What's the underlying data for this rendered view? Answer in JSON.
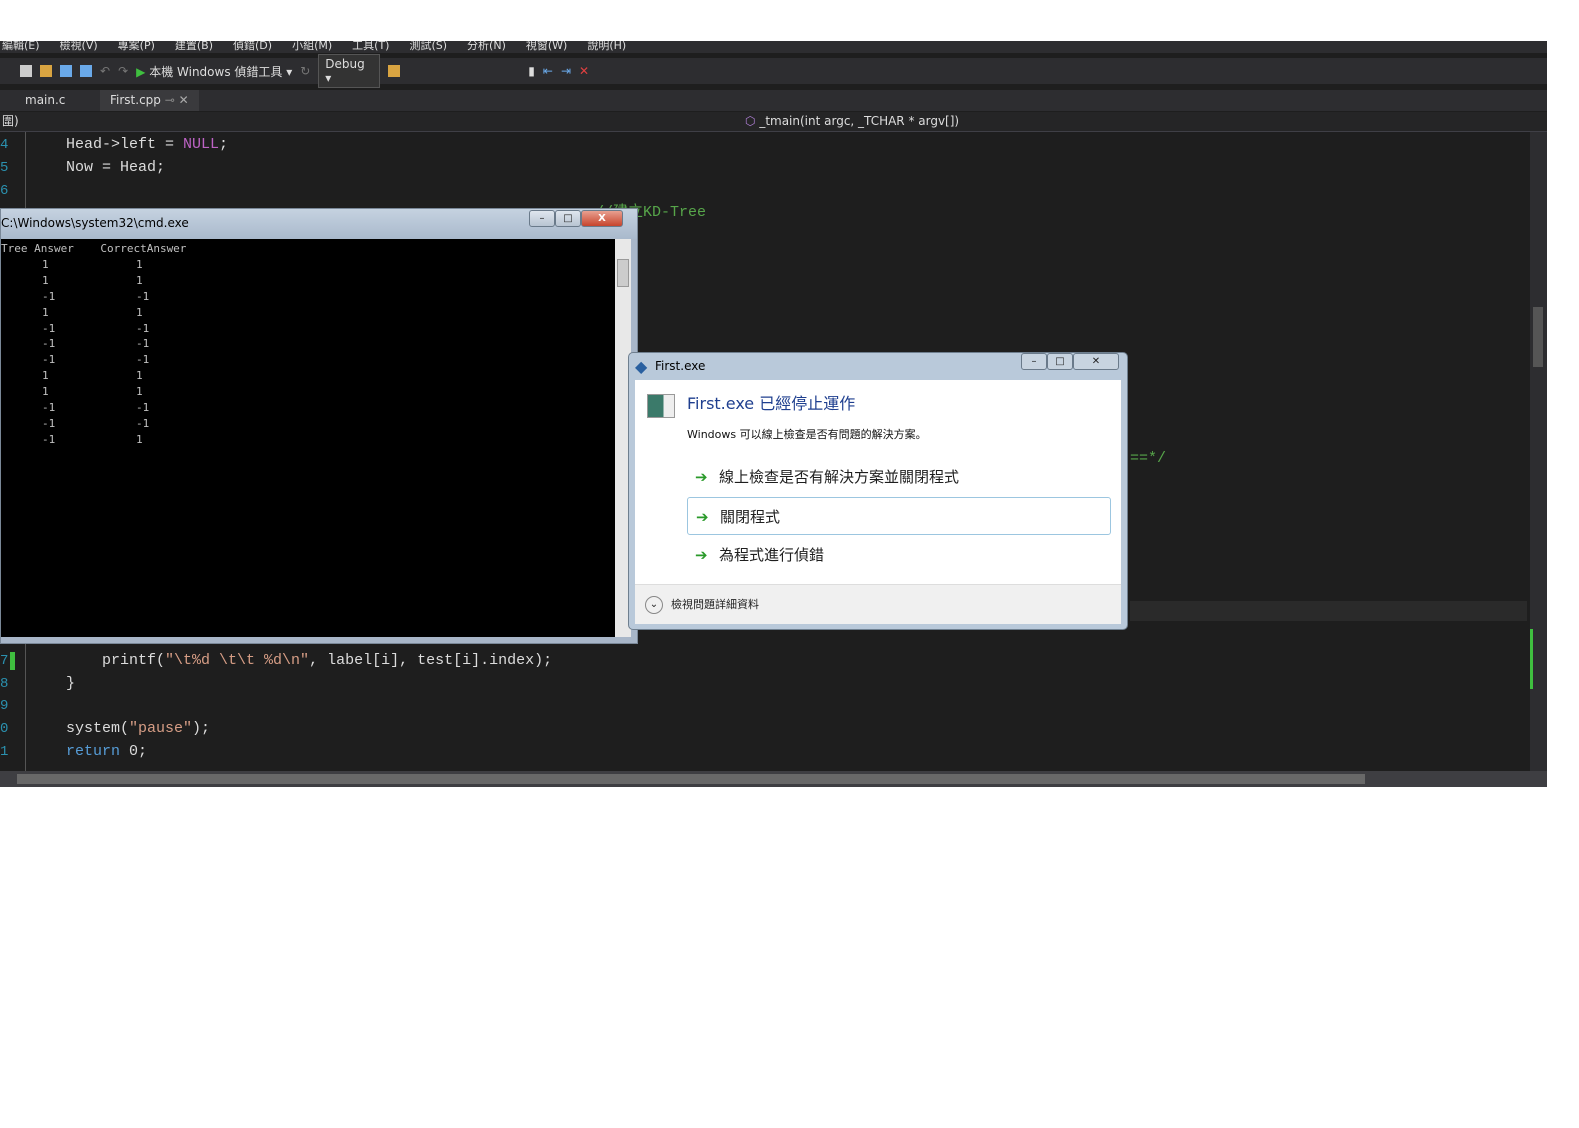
{
  "menu": [
    "編輯(E)",
    "檢視(V)",
    "專案(P)",
    "建置(B)",
    "偵錯(D)",
    "小組(M)",
    "工具(T)",
    "測試(S)",
    "分析(N)",
    "視窗(W)",
    "說明(H)"
  ],
  "toolbar": {
    "run_label": "本機 Windows 偵錯工具",
    "config": "Debug"
  },
  "tabs": [
    "main.c",
    "First.cpp"
  ],
  "navbar": {
    "left": "圍)",
    "function": "_tmain(int argc, _TCHAR * argv[])"
  },
  "code": {
    "l4": {
      "num": "4",
      "a": "    Head->left = ",
      "b": "NULL",
      "c": ";"
    },
    "l5": {
      "num": "5",
      "text": "    Now = Head;"
    },
    "l6": {
      "num": "6"
    },
    "comment1": "//建立KD-Tree",
    "comment2": "==*/",
    "l7": {
      "num": "7",
      "a": "        printf(",
      "b": "\"\\t%d \\t\\t %d\\n\"",
      "c": ", label[i], test[i].index);"
    },
    "l8": {
      "num": "8",
      "text": "    }"
    },
    "l9": {
      "num": "9"
    },
    "l10": {
      "num": "0",
      "a": "    system(",
      "b": "\"pause\"",
      "c": ");"
    },
    "l11": {
      "num": "1",
      "a": "    ",
      "b": "return",
      "c": " 0;"
    }
  },
  "cmd": {
    "title": "C:\\Windows\\system32\\cmd.exe",
    "header": "Tree Answer    CorrectAnswer",
    "rows": [
      [
        "1",
        "1"
      ],
      [
        "1",
        "1"
      ],
      [
        "-1",
        "-1"
      ],
      [
        "1",
        "1"
      ],
      [
        "-1",
        "-1"
      ],
      [
        "-1",
        "-1"
      ],
      [
        "-1",
        "-1"
      ],
      [
        "1",
        "1"
      ],
      [
        "1",
        "1"
      ],
      [
        "-1",
        "-1"
      ],
      [
        "-1",
        "-1"
      ],
      [
        "-1",
        "1"
      ]
    ]
  },
  "dialog": {
    "title": "First.exe",
    "heading": "First.exe 已經停止運作",
    "message": "Windows 可以線上檢查是否有問題的解決方案。",
    "options": [
      "線上檢查是否有解決方案並關閉程式",
      "關閉程式",
      "為程式進行偵錯"
    ],
    "details": "檢視問題詳細資料"
  },
  "colors": {
    "ide_bg": "#1e1e1e",
    "keyword": "#569cd6",
    "string": "#d69d85",
    "comment": "#57a64a",
    "macro": "#bd63c5",
    "arrow": "#2a9a2a"
  }
}
